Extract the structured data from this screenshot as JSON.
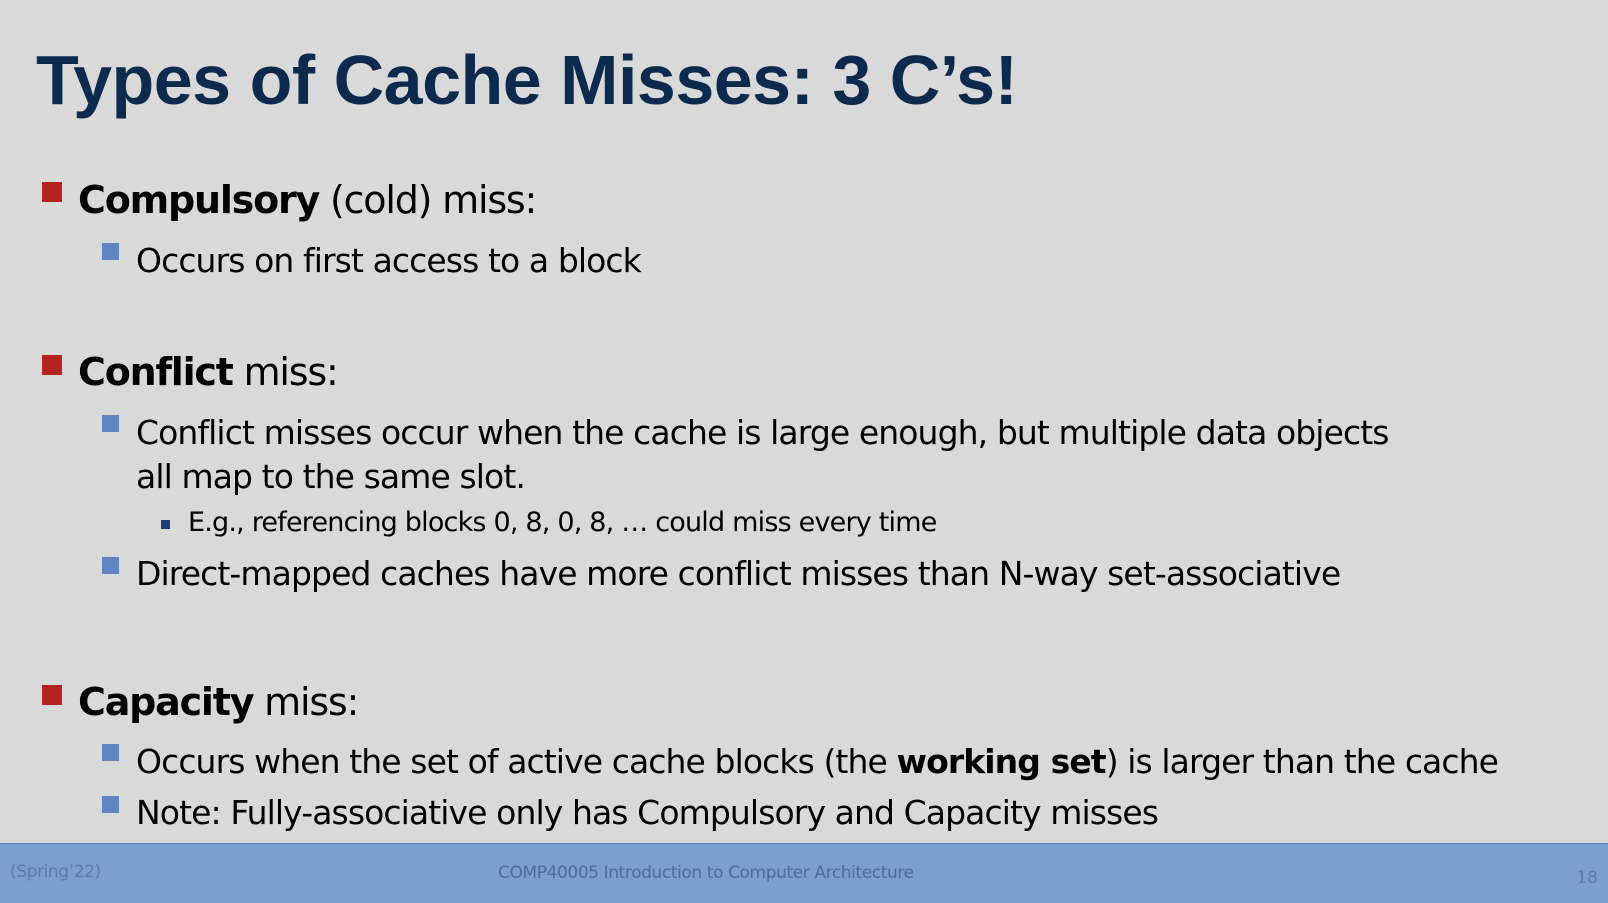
{
  "slide": {
    "title": "Types of Cache Misses: 3 C’s!",
    "compulsory": {
      "term": "Compulsory",
      "rest": " (cold) miss:",
      "points": [
        "Occurs on first access to a block"
      ]
    },
    "conflict": {
      "term": "Conflict",
      "rest": " miss:",
      "point1_line1": "Conflict misses occur when the cache is large enough, but multiple data objects",
      "point1_line2": "all map to the same slot.",
      "sub_example": "E.g., referencing blocks 0, 8, 0, 8, … could miss every time",
      "point2": "Direct-mapped caches have more conflict misses than N-way set-associative"
    },
    "capacity": {
      "term": "Capacity",
      "rest": " miss:",
      "point1_before": "Occurs when the set of active cache blocks (the ",
      "point1_bold": "working set",
      "point1_after": ") is larger than the cache",
      "point2": "Note: Fully-associative only has Compulsory and Capacity misses"
    }
  },
  "footer": {
    "semester": "(Spring’22)",
    "course": "COMP40005 Introduction to Computer Architecture",
    "page_number": "18"
  },
  "colors": {
    "background": "#d9d9d9",
    "title": "#0c2a4e",
    "level1_bullet": "#b5231f",
    "level2_bullet": "#5f86c2",
    "level3_bullet": "#1f3f78",
    "footer_bar": "#7b9fcf"
  }
}
